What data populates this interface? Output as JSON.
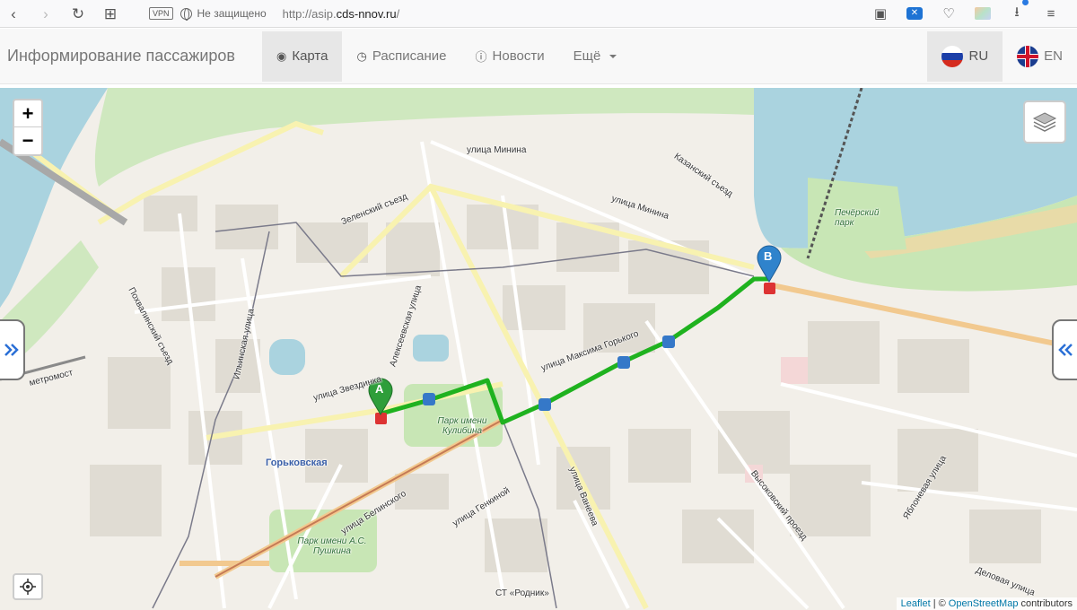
{
  "browser": {
    "vpn_label": "VPN",
    "security_text": "Не защищено",
    "url_prefix": "http://asip.",
    "url_domain": "cds-nnov.ru",
    "url_suffix": "/"
  },
  "navbar": {
    "brand": "Информирование пассажиров",
    "items": [
      {
        "label": "Карта",
        "icon": "map-marker-icon",
        "active": true
      },
      {
        "label": "Расписание",
        "icon": "clock-icon"
      },
      {
        "label": "Новости",
        "icon": "info-icon"
      },
      {
        "label": "Ещё",
        "icon": "caret-down-icon"
      }
    ],
    "languages": [
      {
        "code": "RU",
        "flag": "ru-flag-icon",
        "active": true
      },
      {
        "code": "EN",
        "flag": "uk-flag-icon"
      }
    ]
  },
  "map": {
    "zoom_in": "+",
    "zoom_out": "−",
    "marker_a": "A",
    "marker_b": "B",
    "route_color": "#1fb21f",
    "labels": {
      "minina1": "улица Минина",
      "minina2": "улица Минина",
      "kazansky": "Казанский съезд",
      "pechersky": "Печёрский парк",
      "zelensky": "Зеленский съезд",
      "pokhvalinsky": "Похвалинский съезд",
      "ilyinskaya": "Ильинская улица",
      "alekseevskaya": "Алексеевская улица",
      "zvezdinka": "улица Звездинка",
      "gorkogo": "улица Максима Горького",
      "kulibin": "Парк имени Кулибина",
      "gorkovskaya": "Горьковская",
      "belinskogo": "улица Белинского",
      "genkinoy": "улица Генкиной",
      "vaneeva": "улица Ванеева",
      "pushkin": "Парк имени А.С. Пушкина",
      "vysokovsky": "Высоковский проезд",
      "yablonevaya": "Яблоневая улица",
      "delovaya": "Деловая улица",
      "rodnik": "СТ «Родник»",
      "metromost": "метромост"
    },
    "attribution": {
      "leaflet": "Leaflet",
      "separator": "| ©",
      "osm": "OpenStreetMap",
      "contributors": "contributors"
    }
  }
}
